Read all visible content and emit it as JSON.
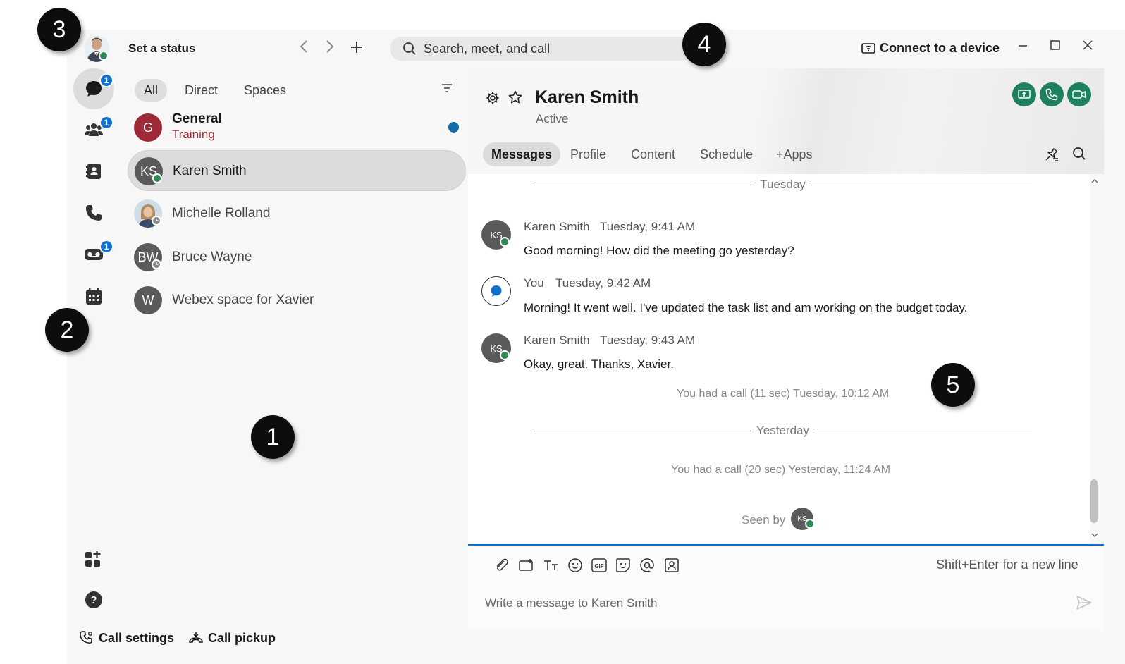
{
  "topbar": {
    "set_status": "Set a status",
    "search_placeholder": "Search, meet, and call",
    "connect_device": "Connect to a device"
  },
  "rail": {
    "messaging_badge": "1",
    "teams_badge": "1",
    "voicemail_badge": "1"
  },
  "list": {
    "filters": [
      "All",
      "Direct",
      "Spaces"
    ],
    "conversations": [
      {
        "name": "General",
        "subtitle": "Training",
        "initial": "G",
        "color": "#9e2a38"
      },
      {
        "name": "Karen Smith",
        "initial": "KS",
        "color": "#5a5a5a"
      },
      {
        "name": "Michelle Rolland"
      },
      {
        "name": "Bruce Wayne",
        "initial": "BW",
        "color": "#5a5a5a"
      },
      {
        "name": "Webex space for Xavier",
        "initial": "W",
        "color": "#5a5a5a"
      }
    ]
  },
  "chat": {
    "contact_name": "Karen Smith",
    "contact_status": "Active",
    "tabs": [
      "Messages",
      "Profile",
      "Content",
      "Schedule",
      "+Apps"
    ],
    "day1": "Tuesday",
    "day2": "Yesterday",
    "messages": [
      {
        "avatar": "KS",
        "sender": "Karen Smith",
        "time": "Tuesday, 9:41 AM",
        "text": "Good morning! How did the meeting go yesterday?"
      },
      {
        "sender": "You",
        "time": "Tuesday, 9:42 AM",
        "text": "Morning! It went well. I've updated the task list and am working on the budget today."
      },
      {
        "avatar": "KS",
        "sender": "Karen Smith",
        "time": "Tuesday, 9:43 AM",
        "text": "Okay, great. Thanks, Xavier."
      }
    ],
    "call_note_1": "You had a call (11 sec) Tuesday, 10:12 AM",
    "call_note_2": "You had a call (20 sec) Yesterday, 11:24 AM",
    "seen_by": "Seen by",
    "seen_avatar": "KS"
  },
  "composer": {
    "hint": "Shift+Enter for a new line",
    "placeholder": "Write a message to Karen Smith"
  },
  "bottom": {
    "call_settings": "Call settings",
    "call_pickup": "Call pickup"
  },
  "callouts": [
    "1",
    "2",
    "3",
    "4",
    "5"
  ],
  "colors": {
    "accent": "#1170cf",
    "call_green": "#1d8160",
    "presence_green": "#2e8b57",
    "general_avatar": "#9e2a38"
  },
  "icons": [
    "messaging-icon",
    "teams-icon",
    "contacts-icon",
    "calling-icon",
    "voicemail-icon",
    "calendar-icon",
    "apps-icon",
    "help-icon",
    "search-icon",
    "settings-gear-icon",
    "star-icon",
    "share-screen-icon",
    "phone-icon",
    "video-icon",
    "pin-icon",
    "attach-icon",
    "screenshot-icon",
    "format-text-icon",
    "emoji-icon",
    "gif-icon",
    "sticker-icon",
    "mention-icon",
    "contact-card-icon",
    "send-icon"
  ]
}
